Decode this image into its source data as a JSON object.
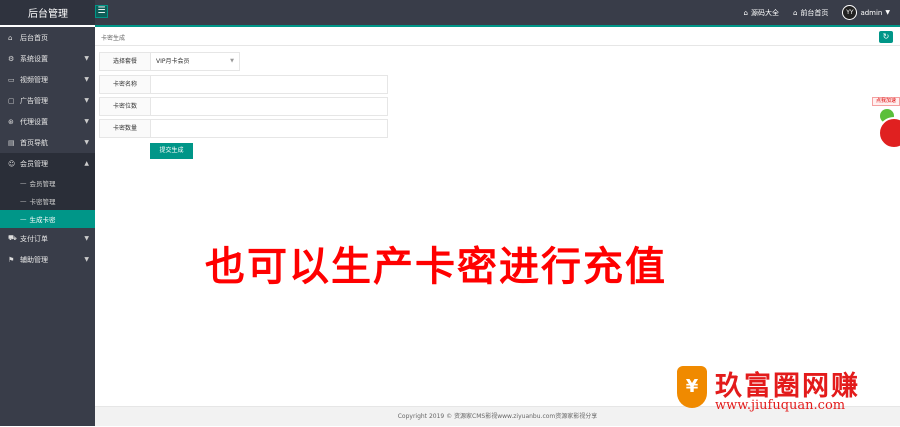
{
  "topbar": {
    "logo": "后台管理",
    "links": [
      {
        "label": "源码大全",
        "icon": "home-icon"
      },
      {
        "label": "前台首页",
        "icon": "home-icon"
      }
    ],
    "avatar_text": "YY",
    "username": "admin"
  },
  "sidebar": {
    "items": [
      {
        "label": "后台首页",
        "icon": "home-icon"
      },
      {
        "label": "系统设置",
        "icon": "gear-icon"
      },
      {
        "label": "视频管理",
        "icon": "monitor-icon"
      },
      {
        "label": "广告管理",
        "icon": "ad-icon"
      },
      {
        "label": "代理设置",
        "icon": "shield-icon"
      },
      {
        "label": "首页导航",
        "icon": "list-icon"
      },
      {
        "label": "会员管理",
        "icon": "user-icon"
      },
      {
        "label": "支付订单",
        "icon": "cart-icon"
      },
      {
        "label": "辅助管理",
        "icon": "flag-icon"
      }
    ],
    "sub_items": [
      {
        "label": "会员管理"
      },
      {
        "label": "卡密管理"
      },
      {
        "label": "生成卡密"
      }
    ]
  },
  "main": {
    "breadcrumb": "卡密生成",
    "form": {
      "package_label": "选择套餐",
      "package_value": "VIP月卡会员",
      "name_label": "卡密名称",
      "length_label": "卡密位数",
      "count_label": "卡密数量",
      "submit": "提交生成"
    },
    "overlay_text": "也可以生产卡密进行充值",
    "footer": "Copyright 2019 © 资源家CMS影视www.ziyuanbu.com资源家影视分享"
  },
  "widget": {
    "tag": "点我加速"
  },
  "watermark": {
    "logo_char": "¥",
    "title": "玖富圈网赚",
    "url": "www.jiufuquan.com"
  },
  "colors": {
    "accent": "#009688",
    "topbar": "#393d49",
    "overlay": "#ff0000"
  }
}
